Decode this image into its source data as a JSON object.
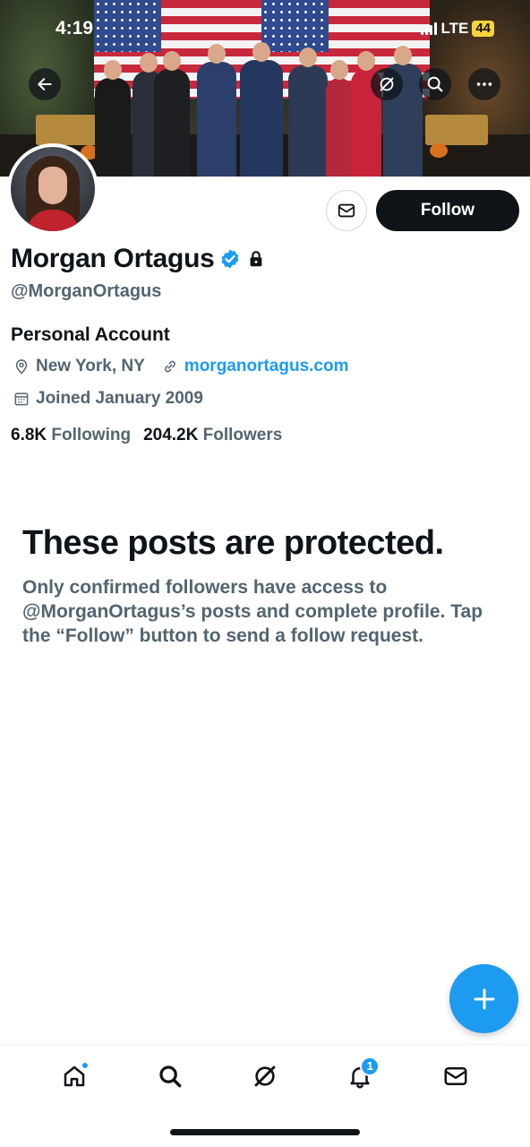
{
  "status_bar": {
    "time": "4:19",
    "network": "LTE",
    "battery": "44"
  },
  "profile": {
    "name": "Morgan Ortagus",
    "handle": "@MorganOrtagus",
    "bio": "Personal Account",
    "location": "New York, NY",
    "website": "morganortagus.com",
    "joined": "Joined January 2009",
    "following_count": "6.8K",
    "following_label": "Following",
    "followers_count": "204.2K",
    "followers_label": "Followers",
    "verified": true,
    "protected": true
  },
  "actions": {
    "follow_label": "Follow"
  },
  "protected_notice": {
    "title": "These posts are protected.",
    "body": "Only confirmed followers have access to @MorganOrtagus’s posts and complete profile. Tap the “Follow” button to send a follow request."
  },
  "bottom_nav": {
    "items": [
      {
        "icon": "home-icon",
        "has_dot": true
      },
      {
        "icon": "search-icon"
      },
      {
        "icon": "grok-icon"
      },
      {
        "icon": "bell-icon",
        "badge": "1"
      },
      {
        "icon": "mail-icon"
      }
    ]
  },
  "colors": {
    "accent": "#1d9bf0",
    "text": "#0f1419",
    "muted": "#536471"
  }
}
